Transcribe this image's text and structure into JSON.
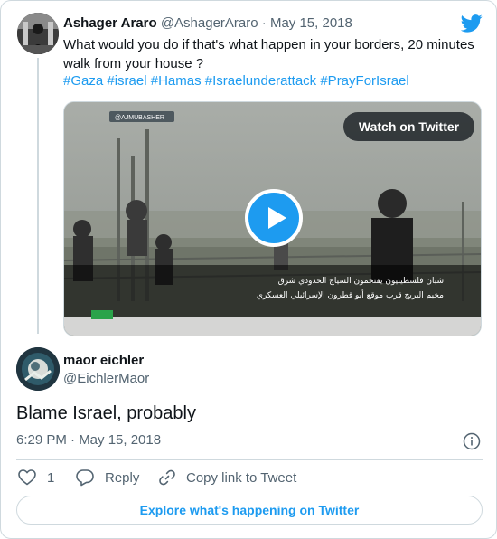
{
  "quoted_tweet": {
    "author_name": "Ashager Araro",
    "author_handle": "@AshagerAraro",
    "separator": " · ",
    "date": "May 15, 2018",
    "text": "What would you do if that's what happen in your borders, 20 minutes walk from your house ?",
    "hashtags": [
      "#Gaza",
      "#israel",
      "#Hamas",
      "#Israelunderattack",
      "#PrayForIsrael"
    ],
    "video": {
      "watch_label": "Watch on Twitter",
      "channel_tag": "@AJMUBASHER",
      "caption_line_1": "شبان فلسطينيون يقتحمون السياج الحدودي شرق",
      "caption_line_2": "مخيم البريج قرب موقع أبو قطرون الإسرائيلي العسكري"
    }
  },
  "reply": {
    "author_name": "maor eichler",
    "author_handle": "@EichlerMaor",
    "text": "Blame Israel, probably",
    "timestamp": "6:29 PM · May 15, 2018"
  },
  "actions": {
    "like_count": "1",
    "reply_label": "Reply",
    "copy_label": "Copy link to Tweet"
  },
  "footer": {
    "explore_label": "Explore what's happening on Twitter"
  },
  "colors": {
    "twitter_blue": "#1d9bf0",
    "text_primary": "#0f1419",
    "text_secondary": "#536471",
    "border": "#cfd9de"
  },
  "icons": [
    "twitter-bird-icon",
    "play-icon",
    "info-icon",
    "heart-icon",
    "reply-bubble-icon",
    "link-icon"
  ]
}
